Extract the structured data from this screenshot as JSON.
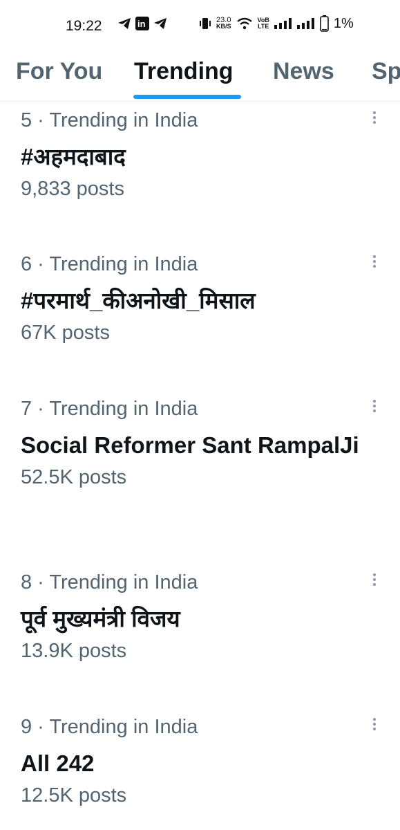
{
  "status_bar": {
    "time": "19:22",
    "net_speed_value": "23.0",
    "net_speed_unit": "KB/S",
    "volte_top": "VoB",
    "volte_bottom": "LTE",
    "battery": "1%"
  },
  "tabs": [
    {
      "label": "For You"
    },
    {
      "label": "Trending"
    },
    {
      "label": "News"
    },
    {
      "label": "Sp"
    }
  ],
  "trends": [
    {
      "meta": "5 · Trending in India",
      "name": "#अहमदाबाद",
      "posts": "9,833 posts"
    },
    {
      "meta": "6 · Trending in India",
      "name": "#परमार्थ_कीअनोखी_मिसाल",
      "posts": "67K posts"
    },
    {
      "meta": "7 · Trending in India",
      "name": "Social Reformer Sant RampalJi",
      "posts": "52.5K posts"
    },
    {
      "meta": "8 · Trending in India",
      "name": "पूर्व मुख्यमंत्री विजय",
      "posts": "13.9K posts"
    },
    {
      "meta": "9 · Trending in India",
      "name": "All 242",
      "posts": "12.5K posts"
    }
  ],
  "colors": {
    "accent": "#1d9bf0",
    "muted_text": "#536471",
    "primary_text": "#0f1419"
  }
}
